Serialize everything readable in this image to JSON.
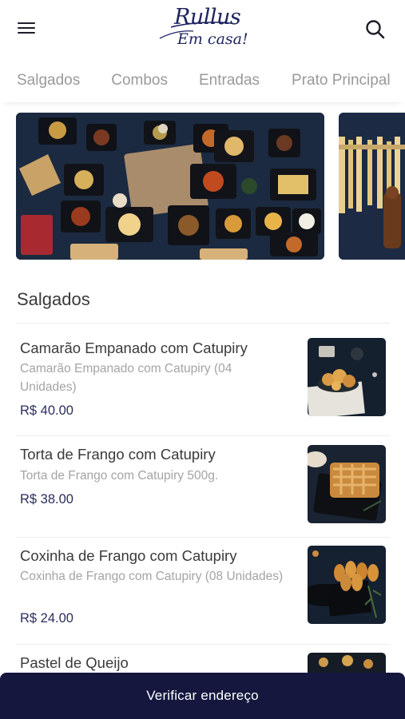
{
  "header": {
    "logo_line1": "Rullus",
    "logo_line2": "Em casa!",
    "menu_icon": "hamburger-menu-icon",
    "search_icon": "search-icon"
  },
  "tabs": [
    {
      "label": "Salgados"
    },
    {
      "label": "Combos"
    },
    {
      "label": "Entradas"
    },
    {
      "label": "Prato Principal"
    }
  ],
  "section": {
    "title": "Salgados"
  },
  "items": [
    {
      "name": "Camarão Empanado com Catupiry",
      "description": "Camarão Empanado com Catupiry (04 Unidades)",
      "price": "R$ 40.00"
    },
    {
      "name": "Torta de Frango com Catupiry",
      "description": "Torta de Frango com Catupiry 500g.",
      "price": "R$ 38.00"
    },
    {
      "name": "Coxinha de Frango com Catupiry",
      "description": "Coxinha de Frango com Catupiry (08 Unidades)",
      "price": "R$ 24.00"
    },
    {
      "name": "Pastel de Queijo"
    }
  ],
  "bottom_bar": {
    "label": "Verificar endereço"
  },
  "colors": {
    "brand_navy": "#15173f",
    "price": "#2b2d5e",
    "tab_inactive": "#9a9a9a"
  }
}
